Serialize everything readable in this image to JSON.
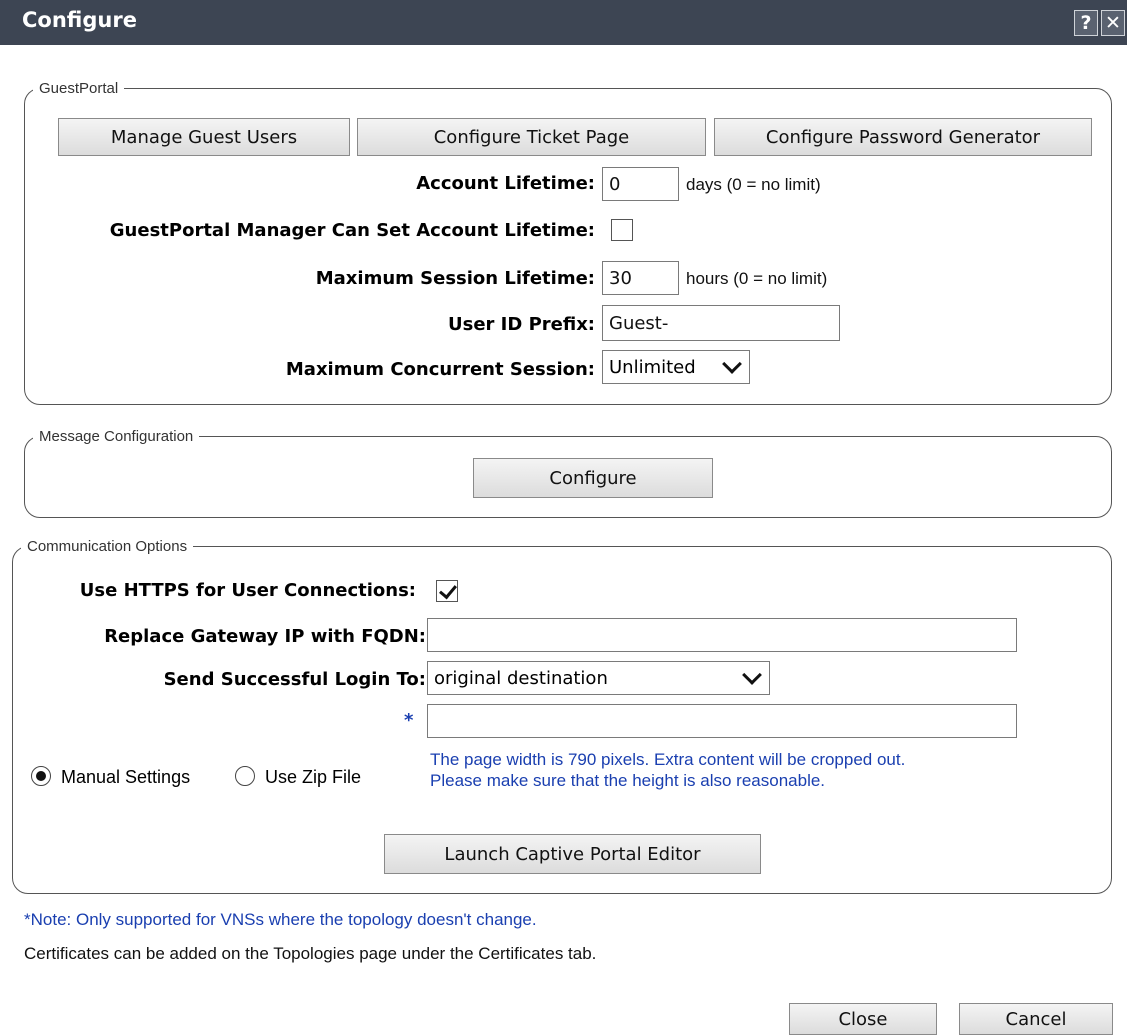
{
  "window": {
    "title": "Configure",
    "help_icon": "help-icon",
    "close_icon": "close-icon",
    "help_glyph": "?",
    "close_glyph": "✕"
  },
  "guestportal": {
    "legend": "GuestPortal",
    "buttons": {
      "manage_guest_users": "Manage Guest Users",
      "configure_ticket_page": "Configure Ticket Page",
      "configure_password_generator": "Configure Password Generator"
    },
    "account_lifetime": {
      "label": "Account Lifetime:",
      "value": "0",
      "hint": "days (0 = no limit)"
    },
    "manager_can_set_lifetime": {
      "label": "GuestPortal Manager Can Set Account Lifetime:",
      "checked": false
    },
    "max_session_lifetime": {
      "label": "Maximum Session Lifetime:",
      "value": "30",
      "hint": "hours (0 = no limit)"
    },
    "user_id_prefix": {
      "label": "User ID Prefix:",
      "value": "Guest-"
    },
    "max_concurrent_session": {
      "label": "Maximum Concurrent Session:",
      "selected": "Unlimited"
    }
  },
  "message_configuration": {
    "legend": "Message Configuration",
    "configure_button": "Configure"
  },
  "communication_options": {
    "legend": "Communication Options",
    "use_https": {
      "label": "Use HTTPS for User Connections:",
      "checked": true
    },
    "replace_gateway": {
      "label": "Replace Gateway IP with FQDN:",
      "value": ""
    },
    "send_login_to": {
      "label": "Send Successful Login To:",
      "selected": "original destination"
    },
    "required_marker": "*",
    "extra_field_value": "",
    "radio_manual": "Manual Settings",
    "radio_zip": "Use Zip File",
    "radio_selected": "Manual Settings",
    "info_line1": "The page width is 790 pixels. Extra content will be cropped out.",
    "info_line2": "Please make sure that the height is also reasonable.",
    "launch_button": "Launch Captive Portal Editor"
  },
  "notes": {
    "note1": "*Note: Only supported for VNSs where the topology doesn't change.",
    "note2": "Certificates can be added on the Topologies page under the Certificates tab."
  },
  "footer": {
    "close_button": "Close",
    "cancel_button": "Cancel"
  }
}
